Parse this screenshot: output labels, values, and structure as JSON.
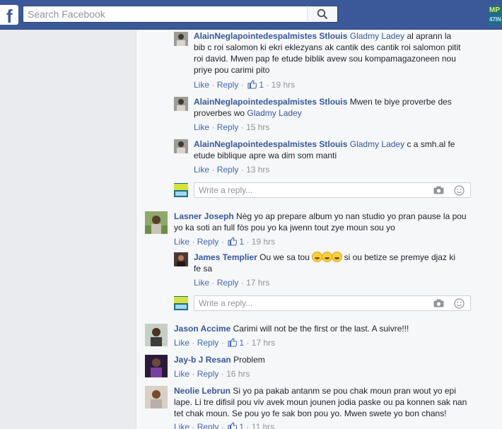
{
  "topbar": {
    "search_placeholder": "Search Facebook",
    "logo": "f",
    "avatar_text_1": "MP",
    "avatar_text_2": "47IN"
  },
  "comments": [
    {
      "author": "AlainNeglapointedespalmistes Stlouis",
      "tag": "Gladmy Ladey",
      "text_lines": [
        "al aprann la",
        "bib c roi salomon ki ekri eklezyans ak cantik des cantik roi salomon pitit",
        "roi david. Mwen pap fe etude biblik avew sou kompamagazoneen nou",
        "priye pou carimi pito"
      ],
      "like": "Like",
      "reply": "Reply",
      "likes": "1",
      "time": "19 hrs"
    },
    {
      "author": "AlainNeglapointedespalmistes Stlouis",
      "text_1": "Mwen te biye proverbe des",
      "text_2": "proverbes wo",
      "tag": "Gladmy Ladey",
      "like": "Like",
      "reply": "Reply",
      "time": "15 hrs"
    },
    {
      "author": "AlainNeglapointedespalmistes Stlouis",
      "tag": "Gladmy Ladey",
      "text_1": "c a smh.al fe",
      "text_2": "etude biblique apre wa dim som manti",
      "like": "Like",
      "reply": "Reply",
      "time": "13 hrs"
    },
    {
      "author": "Lasner Joseph",
      "text_1": "Nèg yo ap prepare album yo nan studio yo pran pause la pou",
      "text_2": "yo ka soti an full fòs pou yo ka jwenn tout zye moun sou yo",
      "like": "Like",
      "reply": "Reply",
      "likes": "1",
      "time": "19 hrs"
    },
    {
      "author": "James Templier",
      "text_1": "Ou we sa tou",
      "text_2": "si ou betize se premye djaz ki",
      "text_3": "fe sa",
      "like": "Like",
      "reply": "Reply",
      "time": "17 hrs"
    },
    {
      "author": "Jason Accime",
      "text": "Carimi will not be the first or the last. A suivre!!!",
      "like": "Like",
      "reply": "Reply",
      "likes": "1",
      "time": "17 hrs"
    },
    {
      "author": "Jay-b J Resan",
      "text": "Problem",
      "like": "Like",
      "reply": "Reply",
      "time": "16 hrs"
    },
    {
      "author": "Neolie Lebrun",
      "text_lines": [
        "Si yo pa pakab antanm se pou chak moun pran wout yo epi",
        "lape. Li tre difisil pou viv avek moun jounen jodia paske ou pa konnen sak nan",
        "tet chak moun. Se pou yo fe sak bon pou yo. Mwen swete yo bon chans!"
      ],
      "like": "Like",
      "reply": "Reply",
      "likes": "1",
      "time": "11 hrs"
    }
  ],
  "reply_boxes": [
    {
      "placeholder": "Write a reply..."
    },
    {
      "placeholder": "Write a reply..."
    }
  ],
  "separator": "·"
}
